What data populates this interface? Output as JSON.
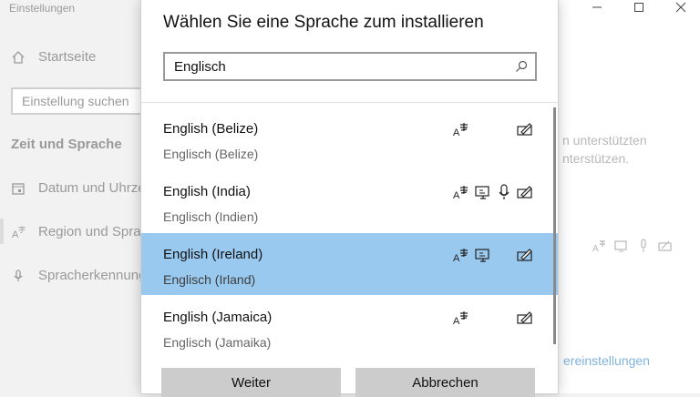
{
  "background": {
    "window_title": "Einstellungen",
    "home_label": "Startseite",
    "search_placeholder": "Einstellung suchen",
    "section_title": "Zeit und Sprache",
    "nav": [
      {
        "label": "Datum und Uhrzeit",
        "icon": "calendar-icon"
      },
      {
        "label": "Region und Sprache",
        "icon": "language-icon"
      },
      {
        "label": "Spracherkennung",
        "icon": "microphone-icon"
      }
    ],
    "right_text_1": "n unterstützten",
    "right_text_2": "nterstützen.",
    "link": "ereinstellungen"
  },
  "dialog": {
    "title": "Wählen Sie eine Sprache zum installieren",
    "search_value": "Englisch",
    "items": [
      {
        "name": "English (Belize)",
        "native": "Englisch (Belize)",
        "features": [
          "language-pack-icon",
          "handwriting-icon"
        ],
        "selected": false
      },
      {
        "name": "English (India)",
        "native": "Englisch (Indien)",
        "features": [
          "language-pack-icon",
          "text-to-speech-icon",
          "speech-recognition-icon",
          "handwriting-icon"
        ],
        "selected": false
      },
      {
        "name": "English (Ireland)",
        "native": "Englisch (Irland)",
        "features": [
          "language-pack-icon",
          "text-to-speech-icon",
          "handwriting-icon"
        ],
        "selected": true
      },
      {
        "name": "English (Jamaica)",
        "native": "Englisch (Jamaika)",
        "features": [
          "language-pack-icon",
          "handwriting-icon"
        ],
        "selected": false
      }
    ],
    "next_label": "Weiter",
    "cancel_label": "Abbrechen"
  },
  "colors": {
    "selection": "#99c9ef",
    "button": "#cccccc",
    "link": "#7fb3e0"
  }
}
